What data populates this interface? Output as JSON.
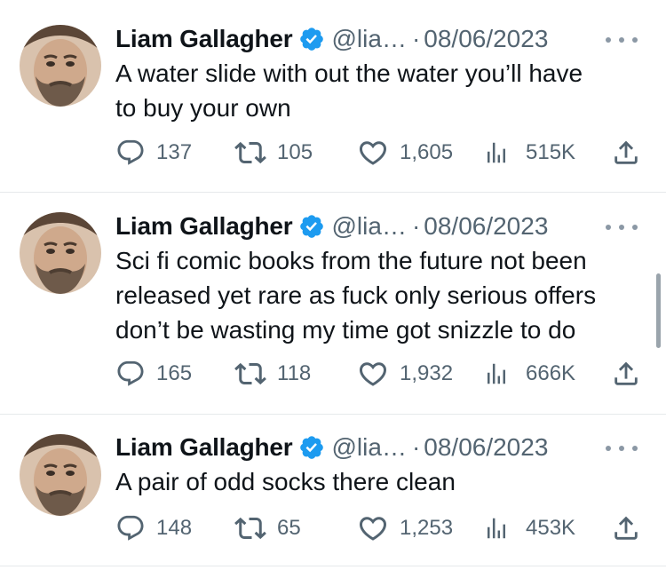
{
  "tweets": [
    {
      "name": "Liam Gallagher",
      "handle": "@lia…",
      "separator": "·",
      "date": "08/06/2023",
      "lines": [
        "A water slide with out the water you’ll have",
        "to buy your own"
      ],
      "replies": "137",
      "retweets": "105",
      "likes": "1,605",
      "views": "515K"
    },
    {
      "name": "Liam Gallagher",
      "handle": "@lia…",
      "separator": "·",
      "date": "08/06/2023",
      "lines": [
        "Sci fi comic books from the future not been",
        "released yet rare as fuck only serious offers",
        "don’t be wasting my time got snizzle to do"
      ],
      "replies": "165",
      "retweets": "118",
      "likes": "1,932",
      "views": "666K"
    },
    {
      "name": "Liam Gallagher",
      "handle": "@lia…",
      "separator": "·",
      "date": "08/06/2023",
      "lines": [
        "A pair of odd socks there clean"
      ],
      "replies": "148",
      "retweets": "65",
      "likes": "1,253",
      "views": "453K"
    }
  ],
  "colors": {
    "text": "#0f1419",
    "muted": "#536471",
    "verified": "#1d9bf0",
    "divider": "#e6e9eb"
  },
  "icons": [
    "reply-icon",
    "retweet-icon",
    "like-icon",
    "views-icon",
    "share-icon",
    "verified-badge-icon",
    "more-options-icon"
  ]
}
